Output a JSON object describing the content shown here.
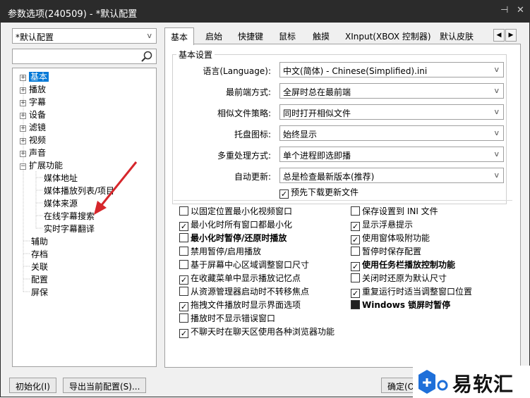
{
  "window": {
    "title": "参数选项(240509) - *默认配置",
    "pin_icon": "pin-icon",
    "close_icon": "close-icon"
  },
  "profile_select": {
    "value": "*默认配置"
  },
  "search": {
    "value": "",
    "icon": "search-icon"
  },
  "tree": {
    "items": [
      {
        "label": "基本",
        "expander": "+",
        "selected": true
      },
      {
        "label": "播放",
        "expander": "+"
      },
      {
        "label": "字幕",
        "expander": "+"
      },
      {
        "label": "设备",
        "expander": "+"
      },
      {
        "label": "滤镜",
        "expander": "+"
      },
      {
        "label": "视频",
        "expander": "+"
      },
      {
        "label": "声音",
        "expander": "+"
      },
      {
        "label": "扩展功能",
        "expander": "−"
      },
      {
        "label": "媒体地址"
      },
      {
        "label": "媒体播放列表/项目"
      },
      {
        "label": "媒体来源"
      },
      {
        "label": "在线字幕搜索"
      },
      {
        "label": "实时字幕翻译"
      },
      {
        "label": "辅助"
      },
      {
        "label": "存档"
      },
      {
        "label": "关联"
      },
      {
        "label": "配置"
      },
      {
        "label": "屏保"
      }
    ]
  },
  "tabs": [
    "基本",
    "启始",
    "快捷键",
    "鼠标",
    "触摸",
    "XInput(XBOX 控制器)",
    "默认皮肤"
  ],
  "tab_nav": [
    "◀",
    "▶"
  ],
  "basic": {
    "group_title": "基本设置",
    "rows": [
      {
        "label": "语言(Language):",
        "value": "中文(简体) - Chinese(Simplified).ini"
      },
      {
        "label": "最前端方式:",
        "value": "全屏时总在最前端"
      },
      {
        "label": "相似文件策略:",
        "value": "同时打开相似文件"
      },
      {
        "label": "托盘图标:",
        "value": "始终显示"
      },
      {
        "label": "多重处理方式:",
        "value": "单个进程即选即播"
      },
      {
        "label": "自动更新:",
        "value": "总是检查最新版本(推荐)"
      }
    ],
    "predownload": {
      "label": "预先下载更新文件",
      "checked": true
    }
  },
  "options_left": [
    {
      "label": "以固定位置最小化视频窗口",
      "state": "unchecked"
    },
    {
      "label": "最小化时所有窗口都最小化",
      "state": "checked"
    },
    {
      "label": "最小化时暂停/还原时播放",
      "state": "unchecked",
      "bold": true
    },
    {
      "label": "禁用暂停/启用播放",
      "state": "unchecked"
    },
    {
      "label": "基于屏幕中心区域调整窗口尺寸",
      "state": "unchecked"
    },
    {
      "label": "在收藏菜单中显示播放记忆点",
      "state": "checked"
    },
    {
      "label": "从资源管理器启动时不转移焦点",
      "state": "unchecked"
    },
    {
      "label": "拖拽文件播放时显示界面选项",
      "state": "checked"
    },
    {
      "label": "播放时不显示错误窗口",
      "state": "unchecked"
    },
    {
      "label": "不聊天时在聊天区使用各种浏览器功能",
      "state": "checked"
    }
  ],
  "options_right": [
    {
      "label": "保存设置到 INI 文件",
      "state": "unchecked"
    },
    {
      "label": "显示浮悬提示",
      "state": "checked"
    },
    {
      "label": "使用窗体吸附功能",
      "state": "checked"
    },
    {
      "label": "暂停时保存配置",
      "state": "unchecked"
    },
    {
      "label": "使用任务栏播放控制功能",
      "state": "checked",
      "bold": true
    },
    {
      "label": "关闭时还原为默认尺寸",
      "state": "unchecked"
    },
    {
      "label": "重复运行时适当调整窗口位置",
      "state": "checked"
    },
    {
      "label": "Windows 锁屏时暂停",
      "state": "indeterminate",
      "bold": true
    }
  ],
  "footer": {
    "init": "初始化(I)",
    "export": "导出当前配置(S)...",
    "ok": "确定(O)"
  },
  "watermark": {
    "text": "易软汇"
  },
  "colors": {
    "title_bg": "#2b2b2b",
    "selection": "#0078d7",
    "dialog_bg": "#f0f0f0",
    "arrow": "#d6262b",
    "watermark_blue": "#1e6fd9"
  }
}
